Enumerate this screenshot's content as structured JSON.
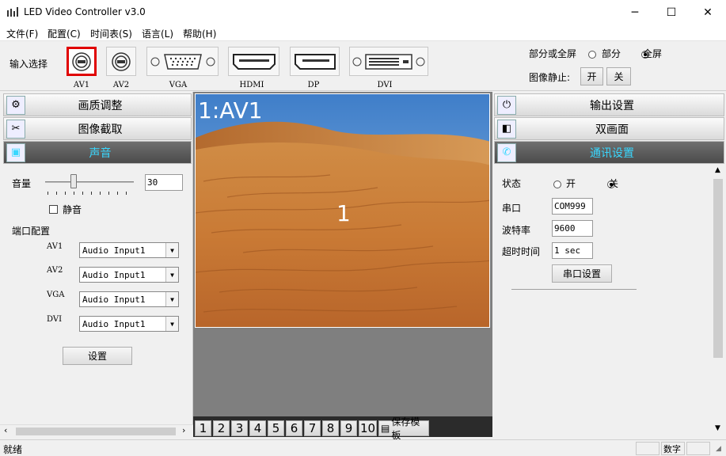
{
  "window": {
    "title": "LED Video Controller v3.0",
    "min": "─",
    "max": "☐",
    "close": "✕"
  },
  "menu": [
    "文件(F)",
    "配置(C)",
    "时间表(S)",
    "语言(L)",
    "帮助(H)"
  ],
  "input": {
    "label": "输入选择",
    "ports": [
      {
        "name": "AV1",
        "selected": true
      },
      {
        "name": "AV2"
      },
      {
        "name": "VGA"
      },
      {
        "name": "HDMI"
      },
      {
        "name": "DP"
      },
      {
        "name": "DVI"
      }
    ]
  },
  "screen": {
    "label": "部分或全屏",
    "partial": "部分",
    "full": "全屏",
    "selected": "全屏"
  },
  "freeze": {
    "label": "图像静止:",
    "on": "开",
    "off": "关"
  },
  "left_tabs": [
    "画质调整",
    "图像截取",
    "声音"
  ],
  "sound": {
    "volume_label": "音量",
    "volume": "30",
    "mute_label": "静音",
    "port_config": "端口配置",
    "rows": [
      {
        "port": "AV1",
        "value": "Audio Input1"
      },
      {
        "port": "AV2",
        "value": "Audio Input1"
      },
      {
        "port": "VGA",
        "value": "Audio Input1"
      },
      {
        "port": "DVI",
        "value": "Audio Input1"
      }
    ],
    "setup": "设置"
  },
  "preview": {
    "source": "1:AV1",
    "window_number": "1",
    "templates": [
      "1",
      "2",
      "3",
      "4",
      "5",
      "6",
      "7",
      "8",
      "9",
      "10"
    ],
    "save_template": "保存模板"
  },
  "right_tabs": [
    "输出设置",
    "双画面",
    "通讯设置"
  ],
  "comm": {
    "state_label": "状态",
    "on": "开",
    "off": "关",
    "selected": "关",
    "port_label": "串口",
    "port": "COM999",
    "baud_label": "波特率",
    "baud": "9600",
    "timeout_label": "超时时间",
    "timeout": "1 sec",
    "serial_setup": "串口设置"
  },
  "status": {
    "text": "就绪",
    "num": "数字"
  }
}
